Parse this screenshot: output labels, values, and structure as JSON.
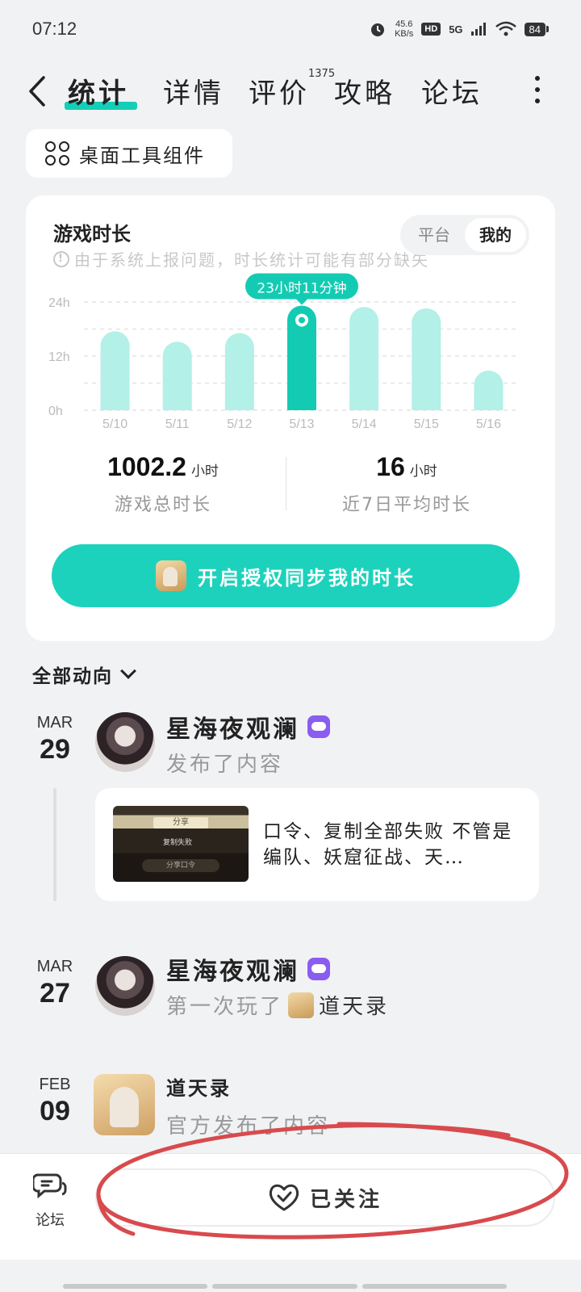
{
  "status_bar": {
    "time": "07:12",
    "net_speed_value": "45.6",
    "net_speed_unit": "KB/s",
    "hd_badge": "HD",
    "signal": "5G",
    "battery": "84"
  },
  "nav": {
    "tabs": [
      {
        "label": "统计",
        "active": true
      },
      {
        "label": "详情",
        "active": false
      },
      {
        "label": "评价",
        "active": false,
        "badge": "1375"
      },
      {
        "label": "攻略",
        "active": false
      },
      {
        "label": "论坛",
        "active": false
      }
    ],
    "accent_color": "#13cfb5"
  },
  "widget_chip": {
    "label": "桌面工具组件"
  },
  "playtime_card": {
    "title": "游戏时长",
    "note": "由于系统上报问题，时长统计可能有部分缺失",
    "segment": {
      "options": [
        "平台",
        "我的"
      ],
      "selected": "我的"
    },
    "stats": {
      "total_value": "1002.2",
      "total_unit": "小时",
      "total_label": "游戏总时长",
      "avg_value": "16",
      "avg_unit": "小时",
      "avg_label": "近7日平均时长"
    },
    "sync_button": "开启授权同步我的时长"
  },
  "chart_data": {
    "type": "bar",
    "categories": [
      "5/10",
      "5/11",
      "5/12",
      "5/13",
      "5/14",
      "5/15",
      "5/16"
    ],
    "values": [
      17.5,
      15.2,
      17.1,
      23.2,
      22.9,
      22.6,
      8.8
    ],
    "y_ticks": [
      "24h",
      "12h",
      "0h"
    ],
    "ylim": [
      0,
      24
    ],
    "highlighted_index": 3,
    "tooltip": "23小时11分钟",
    "bar_color": "#b3f0e7",
    "highlight_color": "#13cbb3",
    "grid": true
  },
  "feed": {
    "filter_label": "全部动向",
    "items": [
      {
        "month": "MAR",
        "day": "29",
        "user": "星海夜观澜",
        "action": "发布了内容",
        "post": {
          "text": "口令、复制全部失败 不管是编队、妖窟征战、天…",
          "thumb_title": "分享",
          "thumb_msg": "复制失败",
          "thumb_btn": "分享口令"
        }
      },
      {
        "month": "MAR",
        "day": "27",
        "user": "星海夜观澜",
        "action": "第一次玩了",
        "game": "道天录"
      },
      {
        "month": "FEB",
        "day": "09",
        "user": "道天录",
        "action": "官方发布了内容"
      }
    ]
  },
  "bottom_bar": {
    "forum_label": "论坛",
    "follow_label": "已关注"
  }
}
